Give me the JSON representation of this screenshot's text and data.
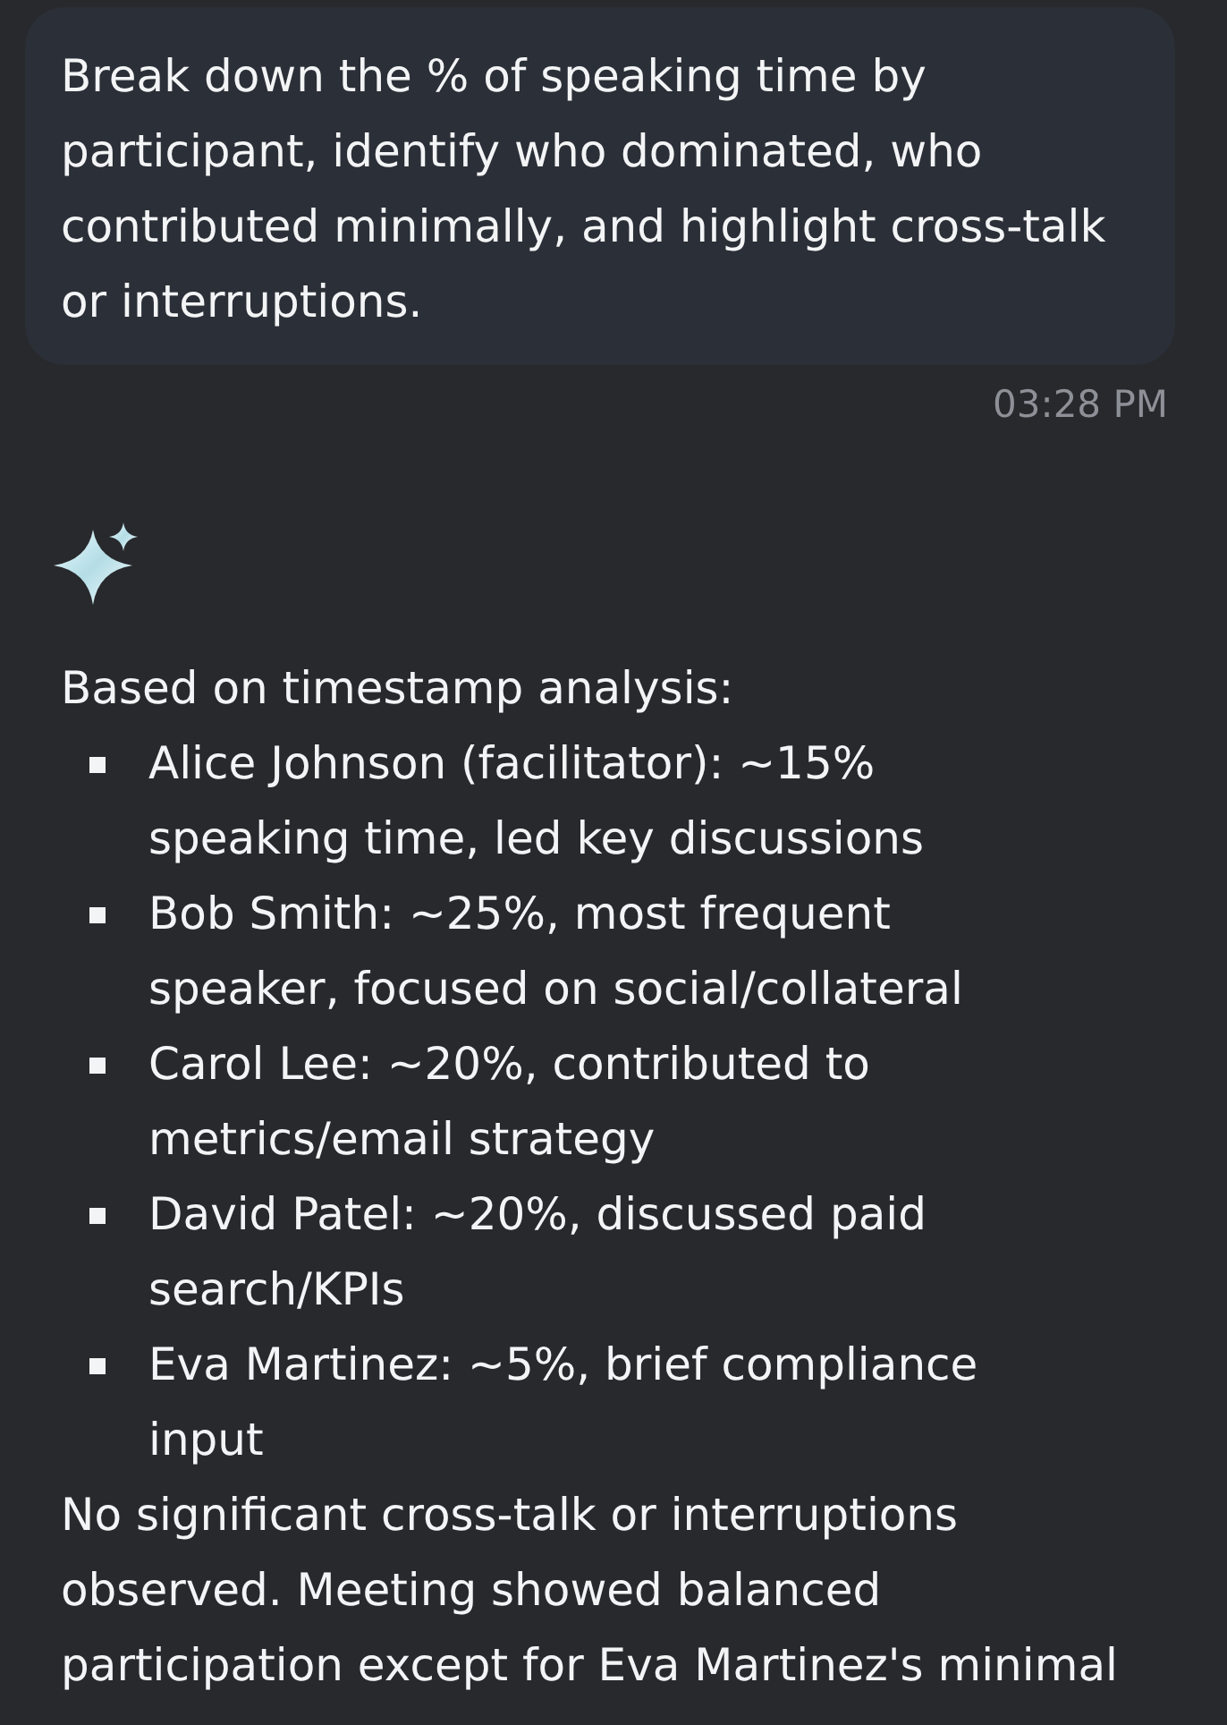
{
  "user_message": {
    "text": "Break down the % of speaking time by participant, identify who dominated, who contributed minimally, and highlight cross-talk or interruptions.",
    "time": "03:28 PM"
  },
  "assistant_message": {
    "intro": "Based on timestamp analysis:",
    "items": [
      "Alice Johnson (facilitator): ~15% speaking time, led key discussions",
      "Bob Smith: ~25%, most frequent speaker, focused on social/collateral",
      "Carol Lee: ~20%, contributed to metrics/email strategy",
      "David Patel: ~20%, discussed paid search/KPIs",
      "Eva Martinez: ~5%, brief compliance input"
    ],
    "summary": "No significant cross-talk or interruptions observed. Meeting showed balanced participation except for Eva Martinez's minimal"
  }
}
